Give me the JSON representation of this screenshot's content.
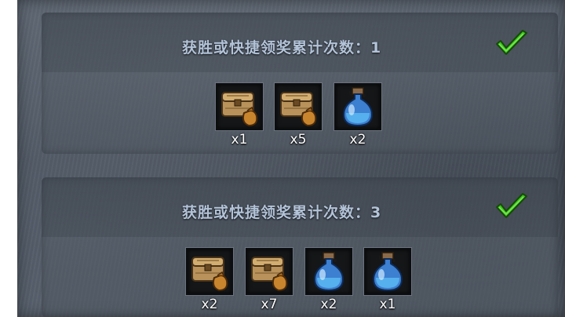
{
  "rewards": [
    {
      "title": "获胜或快捷领奖累计次数：1",
      "claimed": true,
      "items": [
        {
          "icon": "chest-bag-icon",
          "qty": "x1"
        },
        {
          "icon": "chest-bag-icon",
          "qty": "x5"
        },
        {
          "icon": "potion-icon",
          "qty": "x2"
        }
      ]
    },
    {
      "title": "获胜或快捷领奖累计次数：3",
      "claimed": true,
      "items": [
        {
          "icon": "chest-bag-icon",
          "qty": "x2"
        },
        {
          "icon": "chest-bag-icon",
          "qty": "x7"
        },
        {
          "icon": "potion-icon",
          "qty": "x2"
        },
        {
          "icon": "potion-icon",
          "qty": "x1"
        }
      ]
    }
  ],
  "colors": {
    "title": "#b3c3d8",
    "check": "#3fc61e"
  }
}
